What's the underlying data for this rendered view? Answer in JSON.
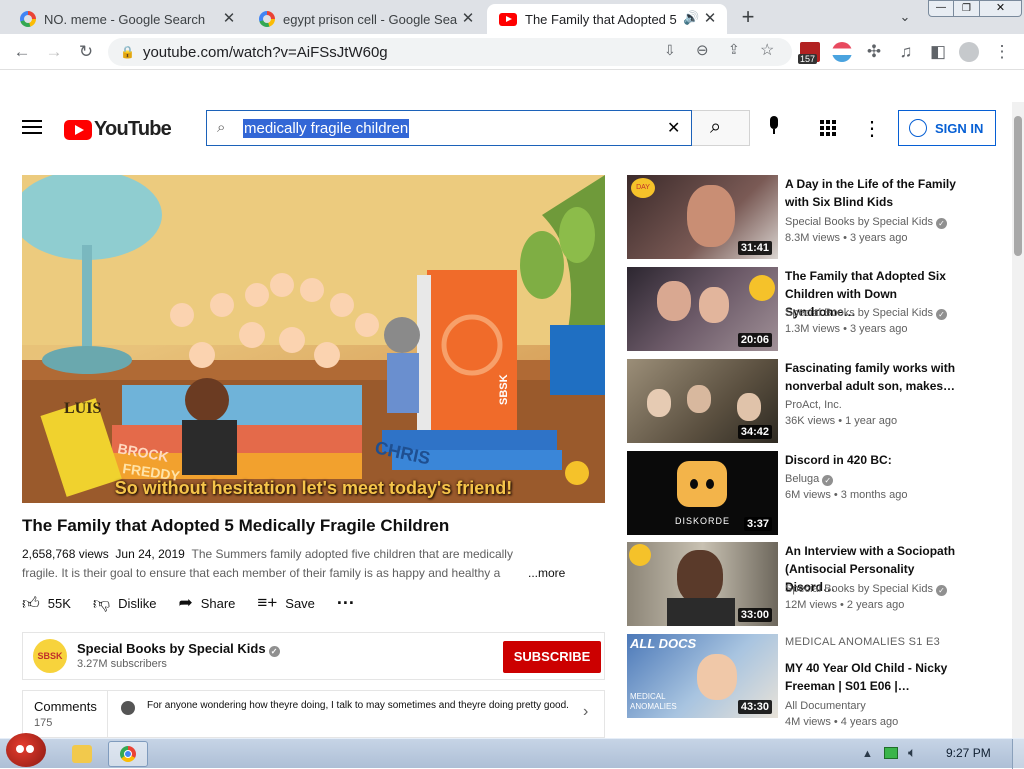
{
  "browser": {
    "tabs": [
      {
        "title": "NO. meme - Google Search",
        "icon": "google-icon",
        "active": false
      },
      {
        "title": "egypt prison cell - Google Sea",
        "icon": "google-icon",
        "active": false
      },
      {
        "title": "The Family that Adopted 5",
        "icon": "youtube-icon",
        "active": true
      }
    ],
    "url": "youtube.com/watch?v=AiFSsJtW60g",
    "extension_badge": "157"
  },
  "youtube": {
    "logo_text": "YouTube",
    "search_query": "medically fragile children",
    "sign_in_label": "SIGN IN"
  },
  "player": {
    "caption": "So without hesitation let's meet today's friend!",
    "scene_labels": [
      "LUIS",
      "BROCK",
      "FREDDY",
      "CHRIS",
      "SBSK"
    ]
  },
  "video": {
    "title": "The Family that Adopted 5 Medically Fragile Children",
    "views": "2,658,768 views",
    "date": "Jun 24, 2019",
    "description_line1": "The Summers family adopted five children that are medically",
    "description_line2": "fragile. It is their goal to ensure that each member of their family is as happy and healthy a",
    "more_label": "...more",
    "likes": "55K",
    "dislike_label": "Dislike",
    "share_label": "Share",
    "save_label": "Save"
  },
  "channel": {
    "name": "Special Books by Special Kids",
    "subscribers": "3.27M subscribers",
    "subscribe_label": "SUBSCRIBE",
    "avatar_text": "SBSK"
  },
  "comments": {
    "label": "Comments",
    "count": "175",
    "top_comment": "For anyone wondering how theyre doing, I talk to may sometimes and theyre doing pretty good."
  },
  "related": [
    {
      "title_line1": "A Day in the Life of the Family",
      "title_line2": "with Six Blind Kids",
      "channel": "Special Books by Special Kids",
      "verified": true,
      "meta": "8.3M views • 3 years ago",
      "duration": "31:41"
    },
    {
      "title_line1": "The Family that Adopted Six",
      "title_line2": "Children with Down Syndrome…",
      "channel": "Special Books by Special Kids",
      "verified": true,
      "meta": "1.3M views • 3 years ago",
      "duration": "20:06"
    },
    {
      "title_line1": "Fascinating family works with",
      "title_line2": "nonverbal adult son, makes…",
      "channel": "ProAct, Inc.",
      "verified": false,
      "meta": "36K views • 1 year ago",
      "duration": "34:42"
    },
    {
      "title_line1": "Discord in 420 BC:",
      "title_line2": "",
      "channel": "Beluga",
      "verified": true,
      "meta": "6M views • 3 months ago",
      "duration": "3:37",
      "thumb_text": "DISKORDE"
    },
    {
      "title_line1": "An Interview with a Sociopath",
      "title_line2": "(Antisocial Personality Disord…",
      "channel": "Special Books by Special Kids",
      "verified": true,
      "meta": "12M views • 2 years ago",
      "duration": "33:00"
    },
    {
      "title_line1": "MY 40 Year Old Child - Nicky",
      "title_line2": "Freeman | S01 E06 |…",
      "channel": "All Documentary",
      "verified": false,
      "meta": "4M views • 4 years ago",
      "duration": "43:30",
      "top_label": "MEDICAL ANOMALIES  S1 E3",
      "thumb_text": "ALL DOCS",
      "thumb_text2": "MEDICAL ANOMALIES"
    }
  ],
  "taskbar": {
    "clock": "9:27 PM"
  }
}
